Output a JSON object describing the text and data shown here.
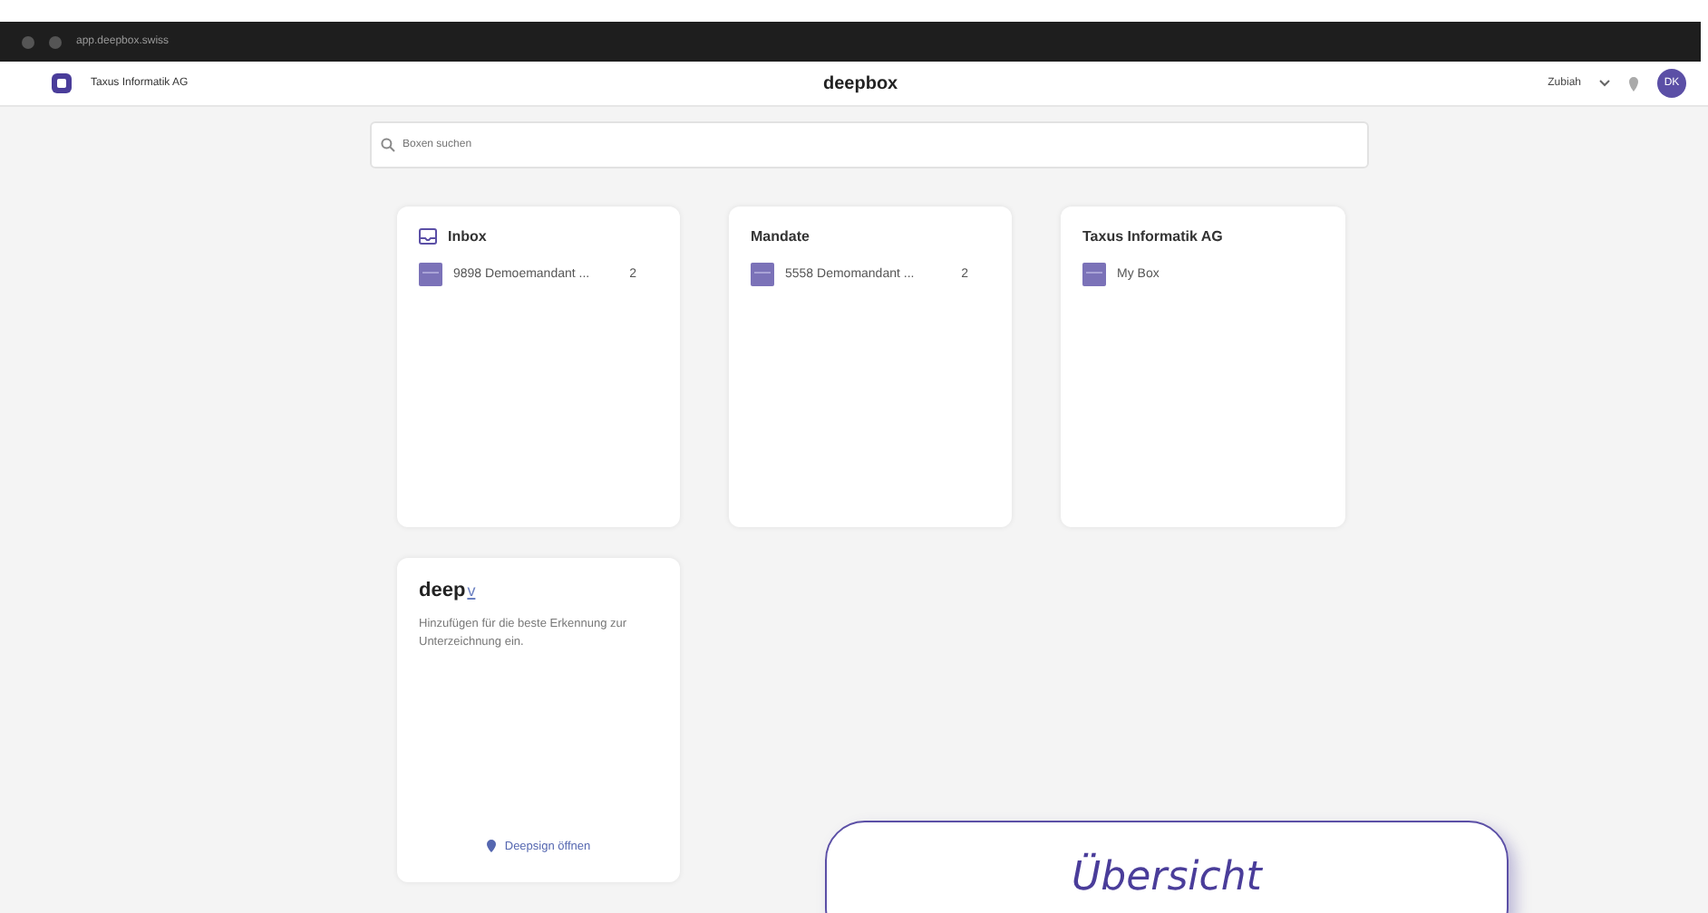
{
  "browser": {
    "url": "app.deepbox.swiss"
  },
  "header": {
    "organization": "Taxus Informatik AG",
    "logo": "deepbox",
    "user_menu": "Zubiah",
    "avatar": "DK"
  },
  "search": {
    "placeholder": "Boxen suchen"
  },
  "cards": [
    {
      "kind": "inbox",
      "title": "Inbox",
      "items": [
        {
          "label": "9898 Demoemandant ...",
          "count": "2"
        }
      ]
    },
    {
      "kind": "plain",
      "title": "Mandate",
      "items": [
        {
          "label": "5558 Demomandant ...",
          "count": "2"
        }
      ]
    },
    {
      "kind": "plain",
      "title": "Taxus Informatik AG",
      "items": [
        {
          "label": "My Box"
        }
      ]
    },
    {
      "kind": "promo",
      "logo": "deep",
      "logo_suffix": "v",
      "description": "Hinzufügen für die beste Erkennung zur Unterzeichnung ein.",
      "link": "Deepsign öffnen"
    }
  ],
  "overlay_button": "Übersicht"
}
